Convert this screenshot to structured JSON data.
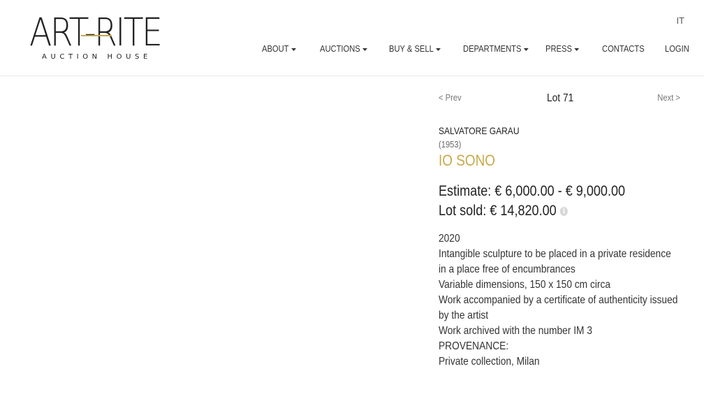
{
  "logo": {
    "main": "ART-RITE",
    "sub": "AUCTION HOUSE"
  },
  "lang": "IT",
  "nav": [
    {
      "label": "ABOUT",
      "dropdown": true
    },
    {
      "label": "AUCTIONS",
      "dropdown": true
    },
    {
      "label": "BUY & SELL",
      "dropdown": true
    },
    {
      "label": "DEPARTMENTS",
      "dropdown": true
    },
    {
      "label": "PRESS",
      "dropdown": true
    },
    {
      "label": "CONTACTS",
      "dropdown": false
    },
    {
      "label": "LOGIN",
      "dropdown": false
    }
  ],
  "lot": {
    "prev": "< Prev",
    "number": "Lot 71",
    "next": "Next >",
    "artist": "SALVATORE GARAU",
    "years": "(1953)",
    "title": "IO SONO",
    "estimate": "Estimate: € 6,000.00 - € 9,000.00",
    "sold": "Lot sold: € 14,820.00",
    "info_icon": "i",
    "description": [
      "2020",
      "Intangible sculpture to be placed in a private residence in a place free of encumbrances",
      "Variable dimensions, 150 x 150 cm circa",
      "Work accompanied by a certificate of authenticity issued by the artist",
      "Work archived with the number IM 3",
      "PROVENANCE:",
      "Private collection, Milan"
    ]
  },
  "colors": {
    "accent": "#c8a94a",
    "text": "#222222",
    "muted": "#777777"
  }
}
